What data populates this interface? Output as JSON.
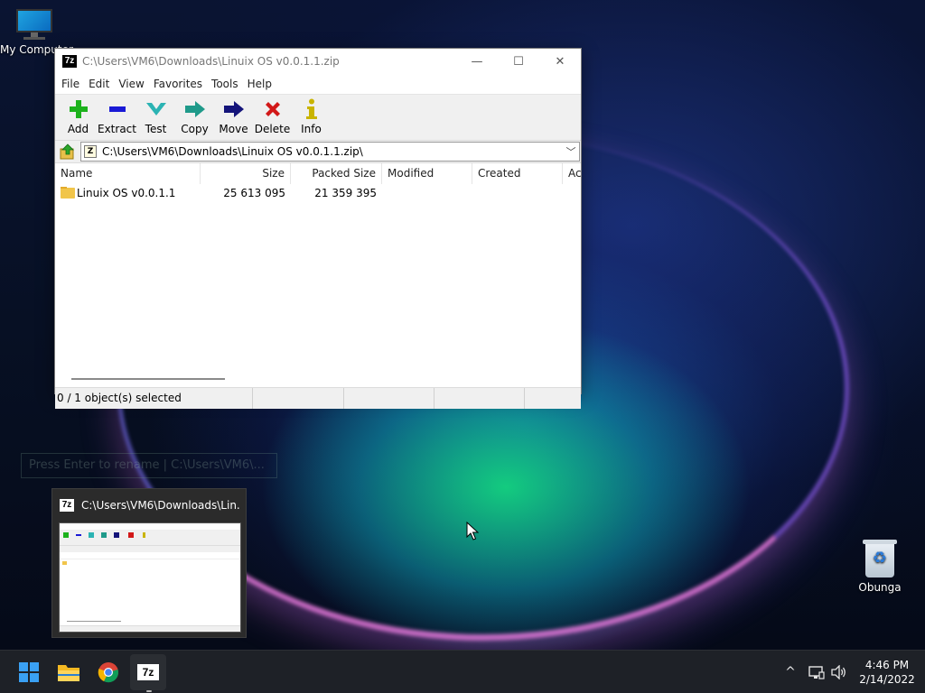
{
  "desktop": {
    "icons": [
      {
        "label": "My Computer",
        "icon": "computer-icon"
      },
      {
        "label": "Obunga",
        "icon": "recycle-bin-icon"
      }
    ]
  },
  "window": {
    "title": "C:\\Users\\VM6\\Downloads\\Linuix OS v0.0.1.1.zip",
    "app_icon_label": "7z",
    "controls": {
      "minimize": "—",
      "maximize": "☐",
      "close": "✕"
    },
    "menu": [
      "File",
      "Edit",
      "View",
      "Favorites",
      "Tools",
      "Help"
    ],
    "toolbar": [
      {
        "label": "Add",
        "icon": "add-icon",
        "color": "#1db21d"
      },
      {
        "label": "Extract",
        "icon": "extract-icon",
        "color": "#1a1ad6"
      },
      {
        "label": "Test",
        "icon": "test-icon",
        "color": "#2bb3b3"
      },
      {
        "label": "Copy",
        "icon": "copy-icon",
        "color": "#1f9a8a"
      },
      {
        "label": "Move",
        "icon": "move-icon",
        "color": "#14147a"
      },
      {
        "label": "Delete",
        "icon": "delete-icon",
        "color": "#d21818"
      },
      {
        "label": "Info",
        "icon": "info-icon",
        "color": "#c9b400"
      }
    ],
    "address": "C:\\Users\\VM6\\Downloads\\Linuix OS v0.0.1.1.zip\\",
    "columns": [
      "Name",
      "Size",
      "Packed Size",
      "Modified",
      "Created",
      "Ac"
    ],
    "rows": [
      {
        "name": "Linuix OS v0.0.1.1",
        "size": "25 613 095",
        "packed_size": "21 359 395",
        "modified": "",
        "created": ""
      }
    ],
    "status": "0 / 1 object(s) selected"
  },
  "tooltip_ghost": "Press Enter to rename  |  C:\\Users\\VM6\\...",
  "preview": {
    "title": "C:\\Users\\VM6\\Downloads\\Lin...",
    "app_icon_label": "7z"
  },
  "taskbar": {
    "apps": [
      "start",
      "file-explorer",
      "chrome",
      "7-zip"
    ],
    "sevenzip_label": "7z",
    "tray_chevron": "^",
    "time": "4:46 PM",
    "date": "2/14/2022"
  }
}
